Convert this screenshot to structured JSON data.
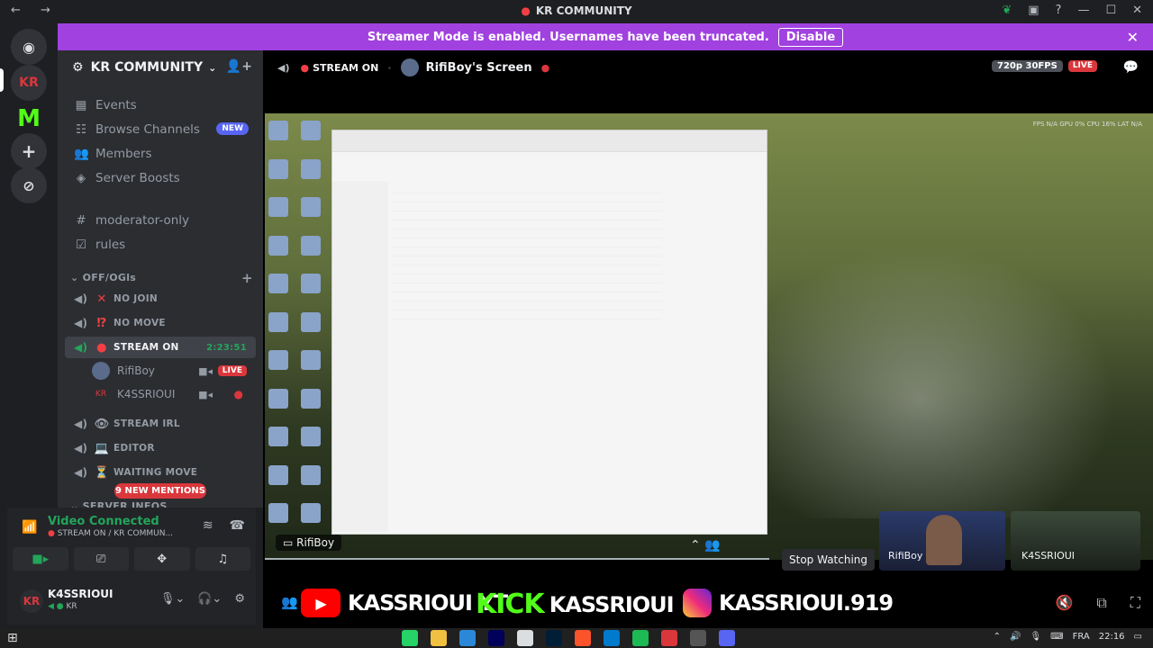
{
  "window": {
    "title": "KR COMMUNITY"
  },
  "banner": {
    "text": "Streamer Mode is enabled. Usernames have been truncated.",
    "button": "Disable"
  },
  "server": {
    "name": "KR COMMUNITY",
    "menu": [
      {
        "label": "Events",
        "icon": "calendar-icon"
      },
      {
        "label": "Browse Channels",
        "icon": "browse-icon",
        "badge": "NEW"
      },
      {
        "label": "Members",
        "icon": "members-icon"
      },
      {
        "label": "Server Boosts",
        "icon": "boost-icon"
      }
    ],
    "text_channels": [
      {
        "label": "moderator-only"
      },
      {
        "label": "rules"
      }
    ],
    "category": "OFF/OGls",
    "voice_channels": [
      {
        "emoji": "✕",
        "label": "NO JOIN"
      },
      {
        "emoji": "⁉",
        "label": "NO MOVE"
      },
      {
        "emoji": "●",
        "label": "STREAM ON",
        "timer": "2:23:51"
      },
      {
        "emoji": "👁",
        "label": "STREAM IRL"
      },
      {
        "emoji": "💻",
        "label": "EDITOR"
      },
      {
        "emoji": "⏳",
        "label": "WAITING MOVE"
      }
    ],
    "voice_users": [
      {
        "name": "RifiBoy",
        "live": "LIVE"
      },
      {
        "name": "K4SSRIOUI"
      }
    ],
    "mentions": "9 NEW MENTIONS",
    "next_category": "SERVER INFOS"
  },
  "voice": {
    "status": "Video Connected",
    "channel": "STREAM ON / KR COMMUN..."
  },
  "user": {
    "name": "K4SSRIOUI",
    "status": "KR"
  },
  "stream": {
    "channel": "STREAM ON",
    "screen_name": "RifiBoy's Screen",
    "quality": "720p 30FPS",
    "live": "LIVE",
    "streamer_label": "RifiBoy",
    "stop": "Stop Watching",
    "perf": "FPS N/A   GPU 0%   CPU 16%   LAT N/A",
    "participants": [
      {
        "name": "RifiBoy"
      },
      {
        "name": "K4SSRIOUI"
      }
    ]
  },
  "social": {
    "youtube": "KASSRIOUI YT",
    "kick_logo": "KICK",
    "kick": "KASSRIOUI",
    "instagram": "KASSRIOUI.919"
  },
  "taskbar": {
    "lang": "FRA",
    "time": "22:16"
  },
  "colors": {
    "accent": "#5865f2",
    "banner": "#a041e0",
    "online": "#23a55a",
    "live": "#da373c"
  }
}
